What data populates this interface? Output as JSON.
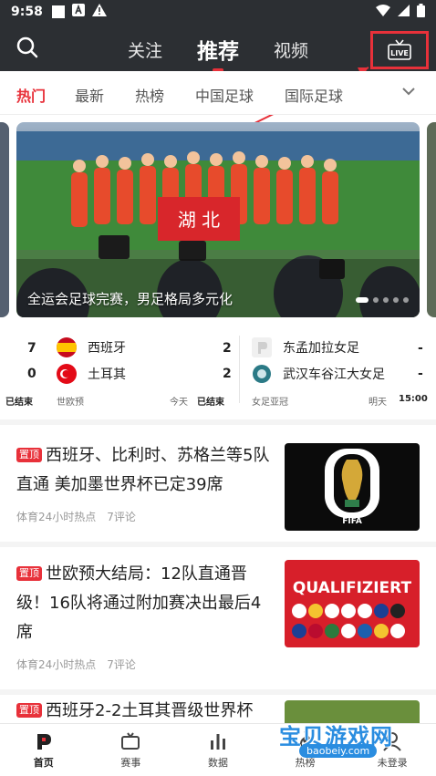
{
  "status_bar": {
    "time": "9:58"
  },
  "top_nav": {
    "tabs": [
      {
        "label": "关注"
      },
      {
        "label": "推荐"
      },
      {
        "label": "视频"
      }
    ],
    "live_label": "LIVE"
  },
  "categories": [
    {
      "label": "热门"
    },
    {
      "label": "最新"
    },
    {
      "label": "热榜"
    },
    {
      "label": "中国足球"
    },
    {
      "label": "国际足球"
    }
  ],
  "banner": {
    "caption": "全运会足球完赛，男足格局多元化",
    "banner_text": "湖 北"
  },
  "scores": [
    {
      "home": {
        "name": "西班牙",
        "score": "2"
      },
      "away": {
        "name": "土耳其",
        "score": "2"
      },
      "status": "已结束",
      "competition": "世欧预",
      "date": "今天"
    },
    {
      "home": {
        "name": "东孟加拉女足",
        "score": "-"
      },
      "away": {
        "name": "武汉车谷江大女足",
        "score": "-"
      },
      "status": "已结束",
      "competition": "女足亚冠",
      "date": "明天",
      "time": "15:00"
    }
  ],
  "partial_score": {
    "home": "7",
    "away": "0"
  },
  "news": [
    {
      "tag": "置顶",
      "title": "西班牙、比利时、苏格兰等5队直通 美加墨世界杯已定39席",
      "source": "体育24小时热点",
      "comments": "7评论",
      "thumb_text": "FIFA"
    },
    {
      "tag": "置顶",
      "title": "世欧预大结局：12队直通晋级！16队将通过附加赛决出最后4席",
      "source": "体育24小时热点",
      "comments": "7评论",
      "thumb_text": "QUALIFIZIERT"
    },
    {
      "tag": "置顶",
      "title": "西班牙2-2土耳其晋级世界杯"
    }
  ],
  "bottom_nav": [
    {
      "label": "首页"
    },
    {
      "label": "赛事"
    },
    {
      "label": "数据"
    },
    {
      "label": "热榜"
    },
    {
      "label": "未登录"
    }
  ],
  "watermark": {
    "text": "宝贝游戏网",
    "url": "baobeiy.com"
  },
  "colors": {
    "accent": "#e8313a",
    "nav_bg": "#2c2f33"
  }
}
